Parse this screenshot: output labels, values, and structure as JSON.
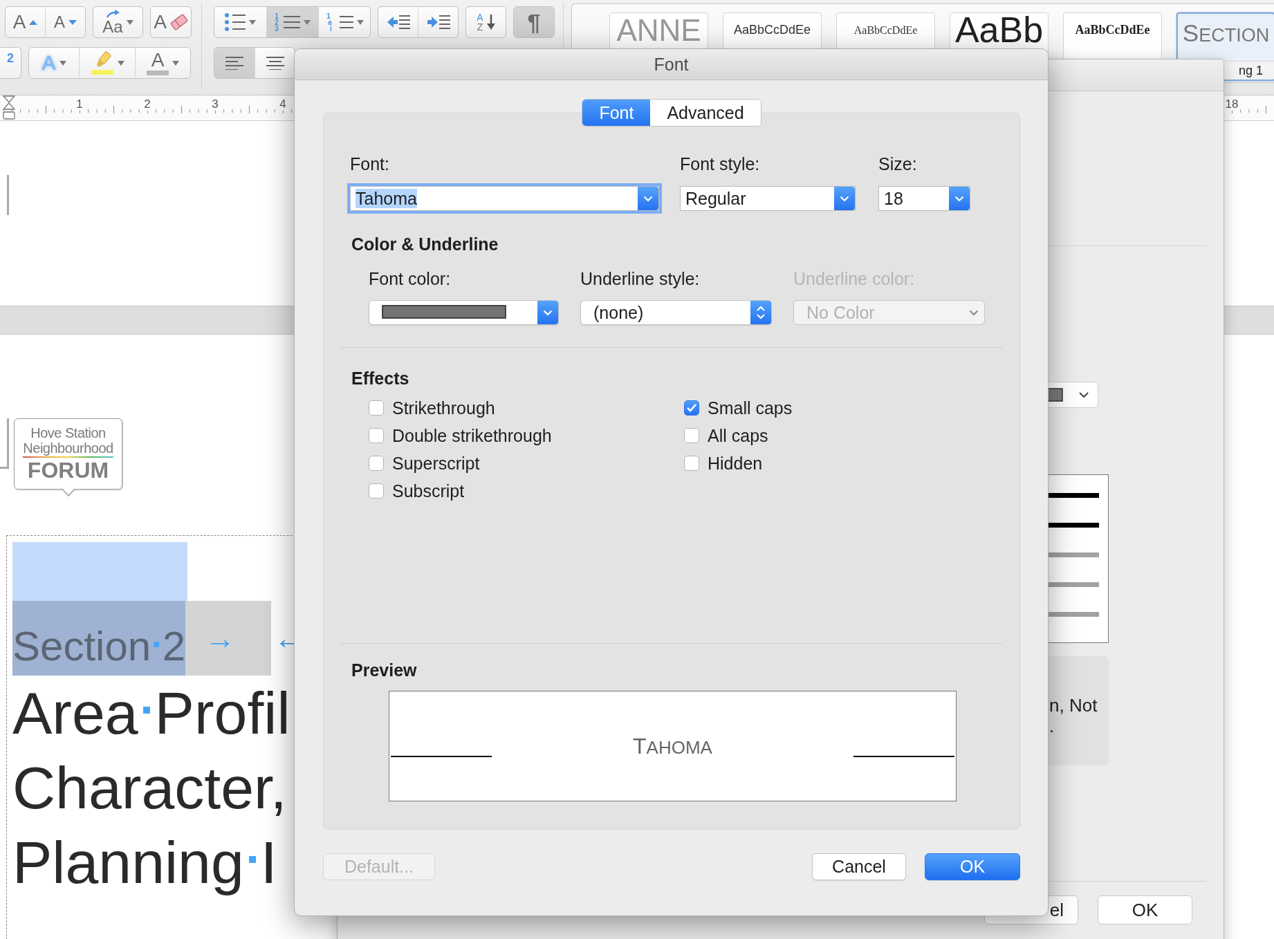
{
  "toolbar": {
    "left_rows": [
      [
        {
          "buttons": [
            {
              "kind": "grow-font",
              "glyph": "A",
              "dropdown": false,
              "selected": false
            },
            {
              "kind": "shrink-font",
              "glyph": "A",
              "dropdown": false,
              "selected": false
            }
          ]
        },
        {
          "buttons": [
            {
              "kind": "change-case",
              "glyph": "Aa",
              "dropdown": true,
              "selected": false
            }
          ]
        },
        {
          "buttons": [
            {
              "kind": "clear-formatting",
              "glyph": "A",
              "dropdown": false,
              "selected": false
            }
          ]
        }
      ],
      [
        {
          "buttons": [
            {
              "kind": "superscript",
              "marks": [
                "2"
              ],
              "dropdown": false,
              "selected": false
            }
          ]
        },
        {
          "buttons": [
            {
              "kind": "text-effects",
              "glyph": "A",
              "dropdown": true,
              "selected": false
            },
            {
              "kind": "highlight",
              "dropdown": true,
              "selected": false
            },
            {
              "kind": "font-color",
              "glyph": "A",
              "dropdown": true,
              "selected": false
            }
          ]
        }
      ]
    ],
    "right_rows": [
      [
        {
          "buttons": [
            {
              "kind": "bullets",
              "dropdown": true,
              "selected": false
            },
            {
              "kind": "numbering",
              "marks": [
                "1",
                "2",
                "3"
              ],
              "dropdown": true,
              "selected": true
            },
            {
              "kind": "multilevel",
              "marks": [
                "1",
                "a",
                "i"
              ],
              "dropdown": true,
              "selected": false
            }
          ]
        },
        {
          "buttons": [
            {
              "kind": "outdent",
              "dropdown": false,
              "selected": false
            },
            {
              "kind": "indent",
              "dropdown": false,
              "selected": false
            }
          ]
        },
        {
          "buttons": [
            {
              "kind": "sort",
              "marks": [
                "A",
                "Z"
              ],
              "dropdown": false,
              "selected": false
            }
          ]
        },
        {
          "buttons": [
            {
              "kind": "pilcrow",
              "glyph": "¶",
              "dropdown": false,
              "selected": true
            }
          ]
        }
      ],
      [
        {
          "buttons": [
            {
              "kind": "align-left",
              "dropdown": false,
              "selected": true
            },
            {
              "kind": "align-center",
              "dropdown": false,
              "selected": false
            }
          ]
        }
      ]
    ],
    "gallery": {
      "styles": [
        {
          "sample": "ANNE",
          "kind": "title",
          "selected": false
        },
        {
          "sample": "AaBbCcDdEe",
          "kind": "normal",
          "selected": false
        },
        {
          "sample": "AaBbCcDdEe",
          "kind": "serif",
          "selected": false
        },
        {
          "sample": "AaBb",
          "kind": "large",
          "selected": false
        },
        {
          "sample": "AaBbCcDdEe",
          "kind": "bold-serif",
          "selected": false
        },
        {
          "sample": "SECTION",
          "kind": "small-caps",
          "label": "ng 1",
          "selected": true
        }
      ]
    }
  },
  "ruler": {
    "numbers": [
      "1",
      "2",
      "3",
      "4"
    ],
    "right_number": "18"
  },
  "document": {
    "logo": {
      "line_1": "Hove Station",
      "line_2": "Neighbourhood",
      "line_3": "FORUM"
    },
    "selected_line": {
      "text": "Section 2",
      "tab_mark": "→",
      "mark_2": "←"
    },
    "heading_lines": [
      "Area Profil",
      "Character,",
      "Planning I"
    ]
  },
  "background_dialog": {
    "panel_text": [
      "n, Not",
      "."
    ],
    "buttons": [
      "el",
      "OK"
    ]
  },
  "font_dialog": {
    "title": "Font",
    "tabs": [
      {
        "label": "Font",
        "selected": true
      },
      {
        "label": "Advanced",
        "selected": false
      }
    ],
    "font": {
      "label": "Font:",
      "value": "Tahoma",
      "focused": true
    },
    "font_style": {
      "label": "Font style:",
      "value": "Regular"
    },
    "size": {
      "label": "Size:",
      "value": "18"
    },
    "color_underline": {
      "heading": "Color & Underline",
      "font_color": {
        "label": "Font color:",
        "color": "#737373"
      },
      "underline_style": {
        "label": "Underline style:",
        "value": "(none)"
      },
      "underline_color": {
        "label": "Underline color:",
        "value": "No Color",
        "disabled": true
      }
    },
    "effects": {
      "heading": "Effects",
      "column_1": [
        {
          "label": "Strikethrough",
          "checked": false
        },
        {
          "label": "Double strikethrough",
          "checked": false
        },
        {
          "label": "Superscript",
          "checked": false
        },
        {
          "label": "Subscript",
          "checked": false
        }
      ],
      "column_2": [
        {
          "label": "Small caps",
          "checked": true
        },
        {
          "label": "All caps",
          "checked": false
        },
        {
          "label": "Hidden",
          "checked": false
        }
      ]
    },
    "preview": {
      "heading": "Preview",
      "sample": "TAHOMA"
    },
    "buttons": [
      {
        "label": "Default...",
        "kind": "default",
        "disabled": true
      },
      {
        "label": "Cancel",
        "kind": "default",
        "disabled": false
      },
      {
        "label": "OK",
        "kind": "primary",
        "disabled": false
      }
    ]
  }
}
